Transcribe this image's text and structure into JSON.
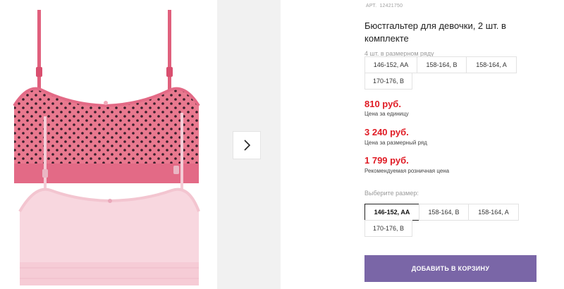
{
  "product": {
    "sku_label": "АРТ.",
    "sku_value": "12421750",
    "title": "Бюстгальтер для девочки, 2 шт. в комплекте",
    "row_note": "4 шт. в размерном ряду",
    "row_sizes": [
      "146-152, AA",
      "158-164, B",
      "158-164, A",
      "170-176, B"
    ],
    "prices": [
      {
        "value": "810 руб.",
        "note": "Цена за единицу"
      },
      {
        "value": "3 240 руб.",
        "note": "Цена за размерный ряд"
      },
      {
        "value": "1 799 руб.",
        "note": "Рекомендуемая розничная цена"
      }
    ],
    "choose_label": "Выберите размер:",
    "size_options": [
      "146-152, AA",
      "158-164, B",
      "158-164, A",
      "170-176, B"
    ],
    "selected_size": "146-152, AA",
    "add_to_cart": "ДОБАВИТЬ В КОРЗИНУ"
  },
  "gallery": {
    "next_icon": "chevron-right-icon",
    "image_description_icon": "product-photo"
  },
  "colors": {
    "price": "#e01b24",
    "button": "#7a66a7",
    "pink_dotted": "#e8788f",
    "pale_pink": "#f7d3dc"
  }
}
